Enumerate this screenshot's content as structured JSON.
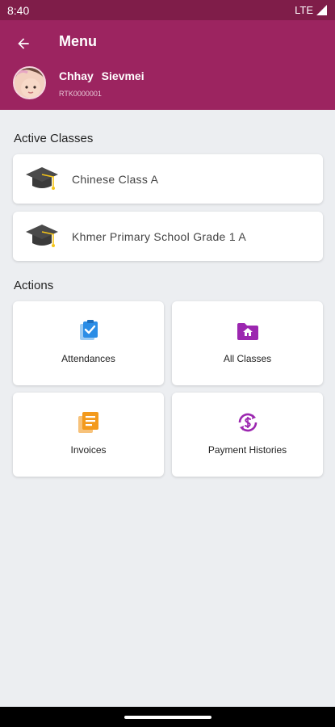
{
  "status_bar": {
    "time": "8:40",
    "network": "LTE"
  },
  "header": {
    "title": "Menu",
    "user_name": "Chhay Sievmei",
    "user_id": "RTK0000001",
    "back_icon": "arrow-left-icon"
  },
  "active_classes": {
    "title": "Active Classes",
    "items": [
      {
        "label": "Chinese Class A",
        "icon": "graduation-cap-icon"
      },
      {
        "label": "Khmer Primary School Grade 1 A",
        "icon": "graduation-cap-icon"
      }
    ]
  },
  "actions": {
    "title": "Actions",
    "items": [
      {
        "label": "Attendances",
        "icon": "clipboard-check-icon",
        "color": "#2b8de6"
      },
      {
        "label": "All Classes",
        "icon": "folder-home-icon",
        "color": "#9c27b0"
      },
      {
        "label": "Invoices",
        "icon": "invoice-stack-icon",
        "color": "#f39a1c"
      },
      {
        "label": "Payment Histories",
        "icon": "payment-cycle-icon",
        "color": "#9c27b0"
      }
    ]
  },
  "colors": {
    "status_bar": "#7f1d49",
    "app_bar": "#9c2460",
    "background": "#eceef1"
  }
}
